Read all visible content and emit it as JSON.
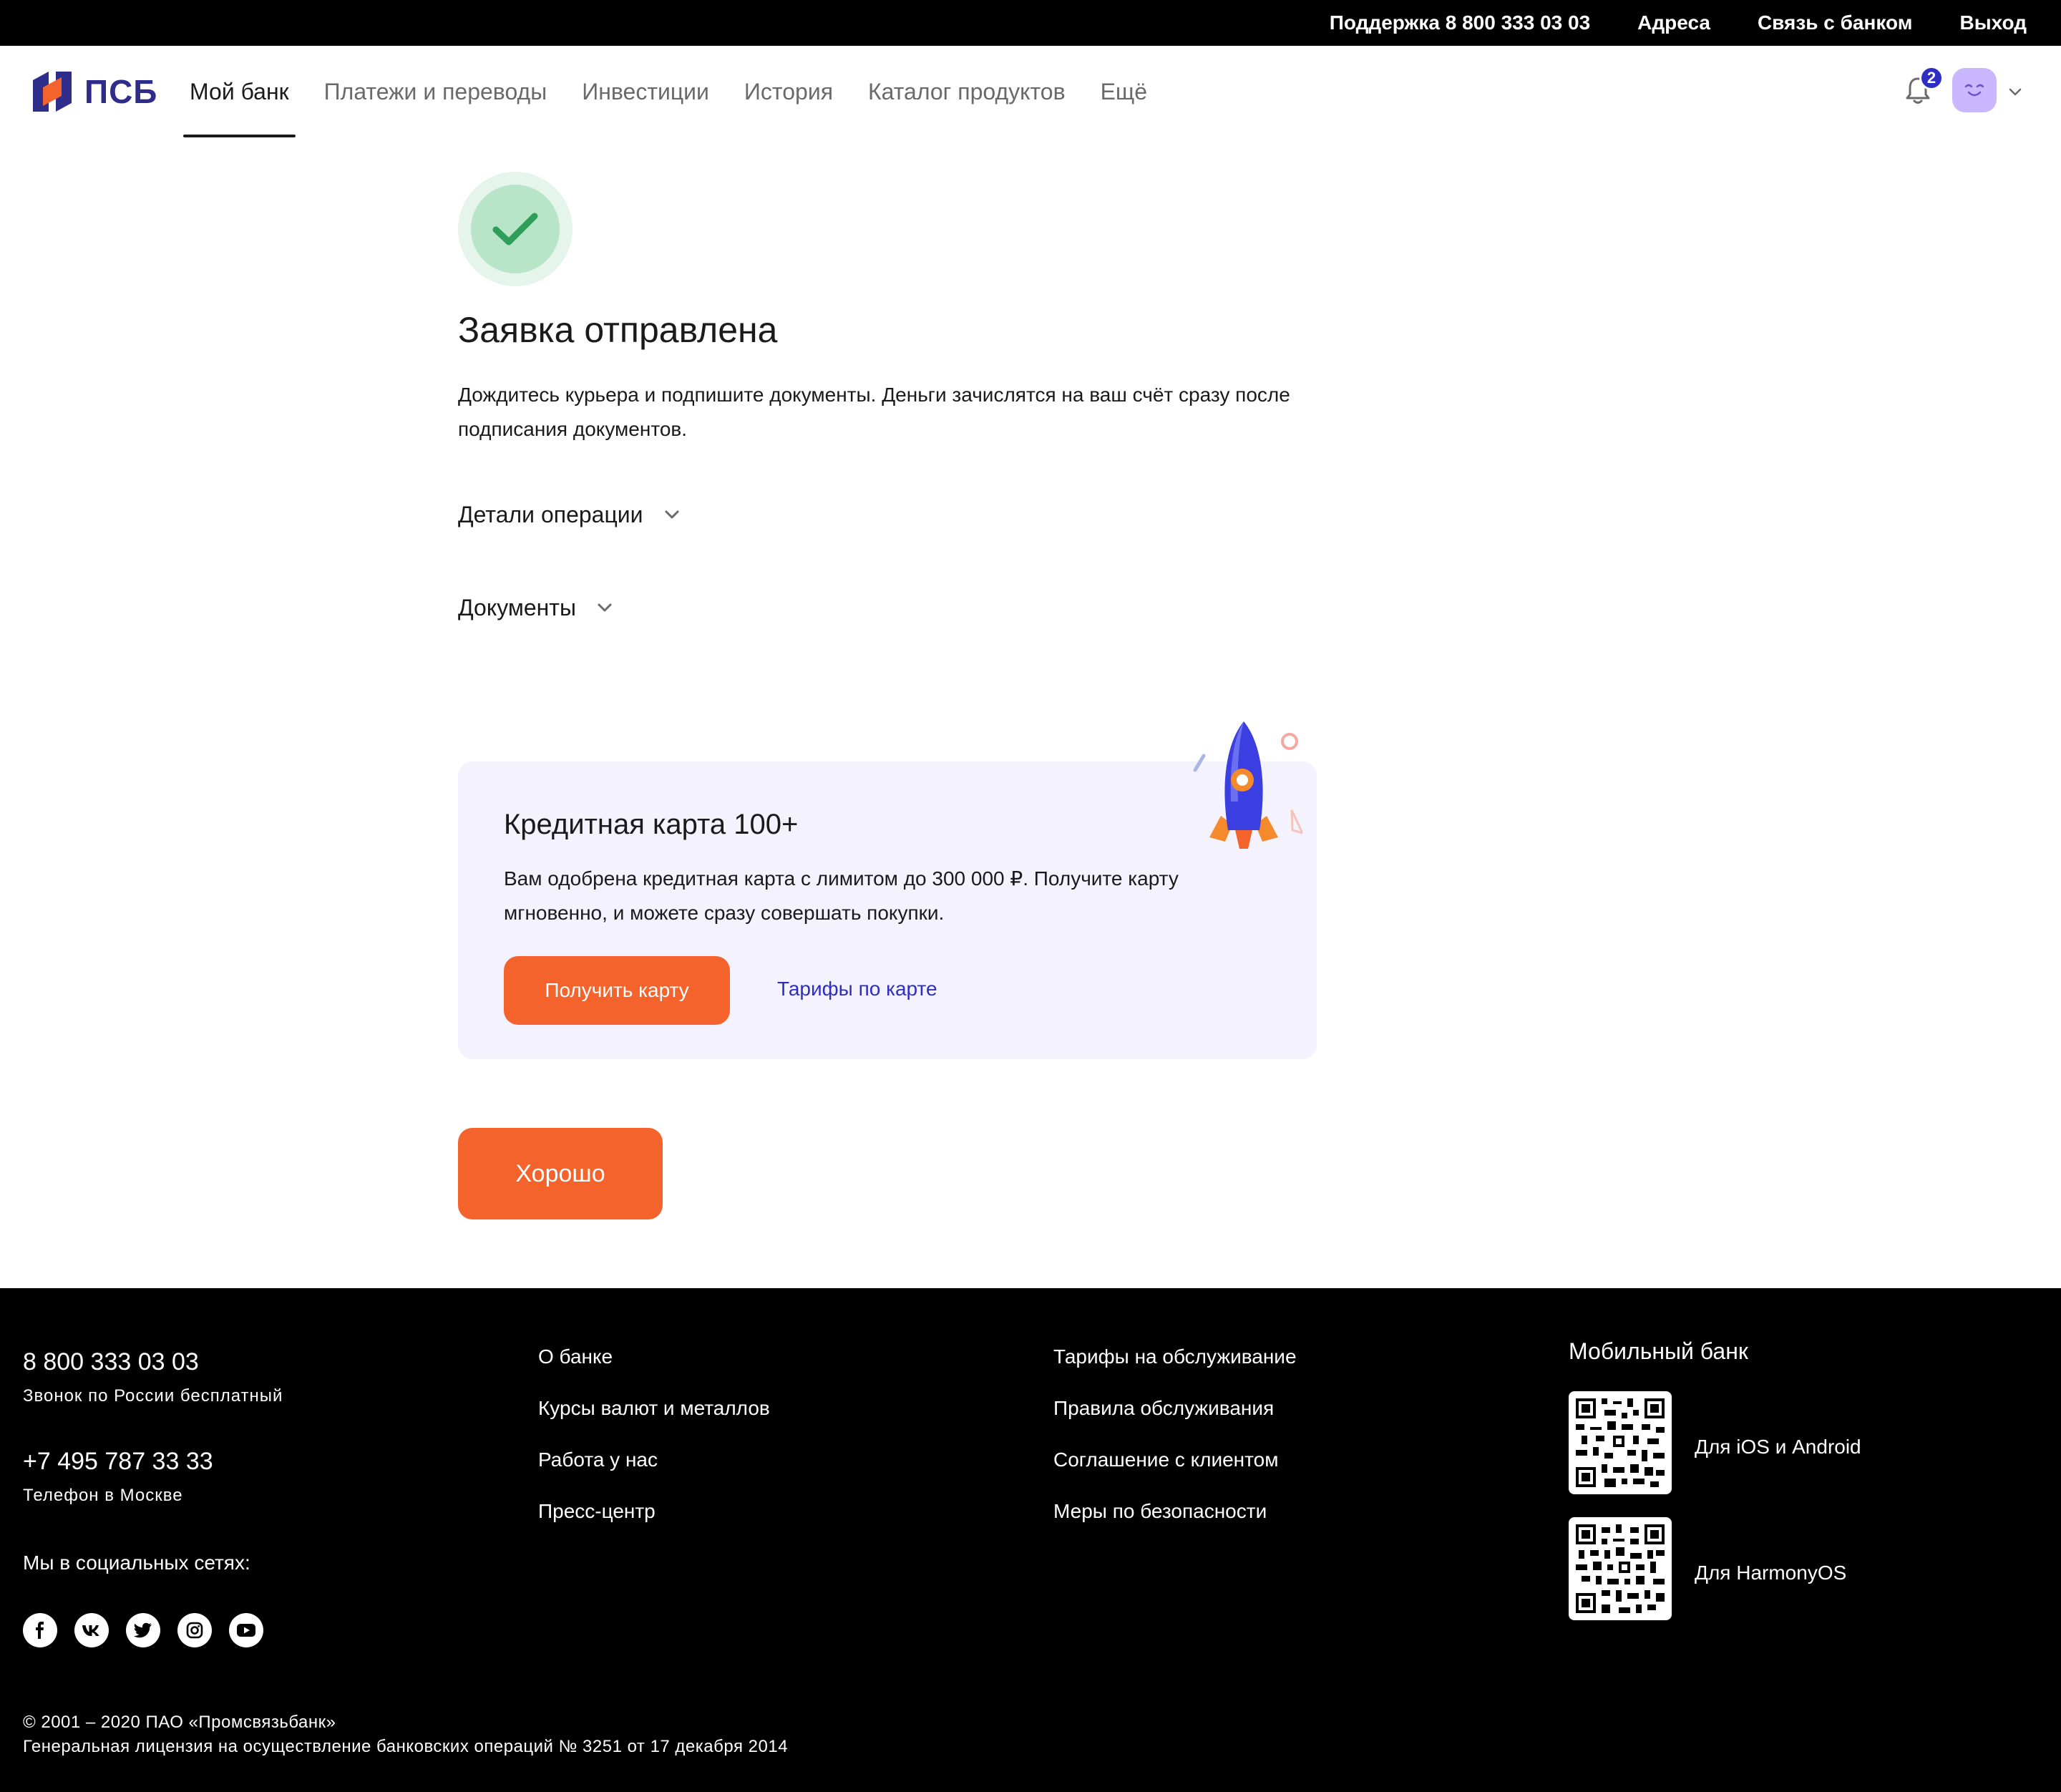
{
  "topbar": {
    "support": "Поддержка 8 800 333 03 03",
    "addresses": "Адреса",
    "contact": "Связь с банком",
    "logout": "Выход"
  },
  "header": {
    "logo_text": "ПСБ",
    "nav": [
      {
        "label": "Мой банк",
        "active": true
      },
      {
        "label": "Платежи и переводы",
        "active": false
      },
      {
        "label": "Инвестиции",
        "active": false
      },
      {
        "label": "История",
        "active": false
      },
      {
        "label": "Каталог продуктов",
        "active": false
      },
      {
        "label": "Ещё",
        "active": false
      }
    ],
    "notifications_count": "2"
  },
  "main": {
    "title": "Заявка отправлена",
    "description": "Дождитесь курьера и подпишите документы. Деньги зачислятся на ваш счёт сразу после подписания документов.",
    "accordion_details": "Детали операции",
    "accordion_documents": "Документы",
    "ok_button": "Хорошо"
  },
  "promo": {
    "title": "Кредитная карта 100+",
    "text": "Вам одобрена кредитная карта с лимитом до 300 000 ₽. Получите карту мгновенно, и можете сразу совершать покупки.",
    "button": "Получить карту",
    "link": "Тарифы по карте"
  },
  "footer": {
    "phone1": "8 800 333 03 03",
    "phone1_note": "Звонок по России бесплатный",
    "phone2": "+7 495 787 33 33",
    "phone2_note": "Телефон в Москве",
    "social_heading": "Мы в социальных сетях:",
    "links_col1": [
      "О банке",
      "Курсы валют и металлов",
      "Работа у нас",
      "Пресс-центр"
    ],
    "links_col2": [
      "Тарифы на обслуживание",
      "Правила обслуживания",
      "Соглашение с клиентом",
      "Меры по безопасности"
    ],
    "mobile_heading": "Мобильный банк",
    "qr_ios_android": "Для iOS и Android",
    "qr_harmony": "Для HarmonyOS",
    "copyright_line1": "© 2001 – 2020 ПАО «Промсвязьбанк»",
    "copyright_line2": "Генеральная лицензия на осуществление банковских операций № 3251 от 17 декабря 2014"
  },
  "colors": {
    "brand_blue": "#2e2d8c",
    "accent_orange": "#f4632b",
    "link_blue": "#2e2ec4",
    "success_green": "#2f9e5a",
    "promo_bg": "#f3f2fd"
  },
  "icons": {
    "bell": "bell-icon",
    "chevron": "chevron-down-icon",
    "check": "check-icon",
    "social": [
      "facebook-icon",
      "vk-icon",
      "twitter-icon",
      "instagram-icon",
      "youtube-icon"
    ]
  }
}
